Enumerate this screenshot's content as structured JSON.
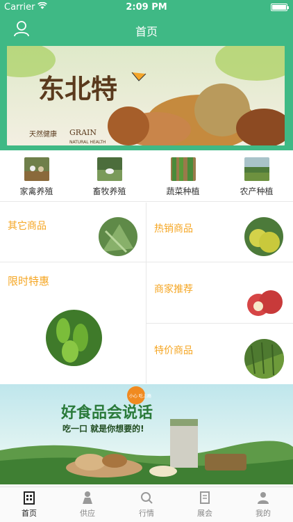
{
  "status": {
    "carrier": "Carrier",
    "time": "2:09 PM"
  },
  "nav": {
    "title": "首页",
    "left_icon": "user-icon"
  },
  "banner": {
    "title": "东北特",
    "side": "天然健康",
    "brand": "GRAIN",
    "sub": "NATURAL HEALTH"
  },
  "categories": [
    {
      "label": "家禽养殖",
      "icon": "poultry-thumbnail"
    },
    {
      "label": "畜牧养殖",
      "icon": "livestock-thumbnail"
    },
    {
      "label": "蔬菜种植",
      "icon": "vegetable-thumbnail"
    },
    {
      "label": "农产种植",
      "icon": "farm-thumbnail"
    }
  ],
  "grid": {
    "other": "其它商品",
    "hot": "热销商品",
    "limited": "限时特惠",
    "merchant": "商家推荐",
    "special": "特价商品"
  },
  "ad": {
    "headline": "好食品会说话",
    "tagline": "吃一口 就是你想要的!",
    "badge": "小心 吃上瘾"
  },
  "tabs": [
    {
      "label": "首页",
      "icon": "home-icon",
      "active": true
    },
    {
      "label": "供应",
      "icon": "supply-icon"
    },
    {
      "label": "行情",
      "icon": "market-icon"
    },
    {
      "label": "展会",
      "icon": "exhibition-icon"
    },
    {
      "label": "我的",
      "icon": "profile-icon"
    }
  ],
  "colors": {
    "primary": "#3fb985",
    "accent": "#f5a623"
  }
}
